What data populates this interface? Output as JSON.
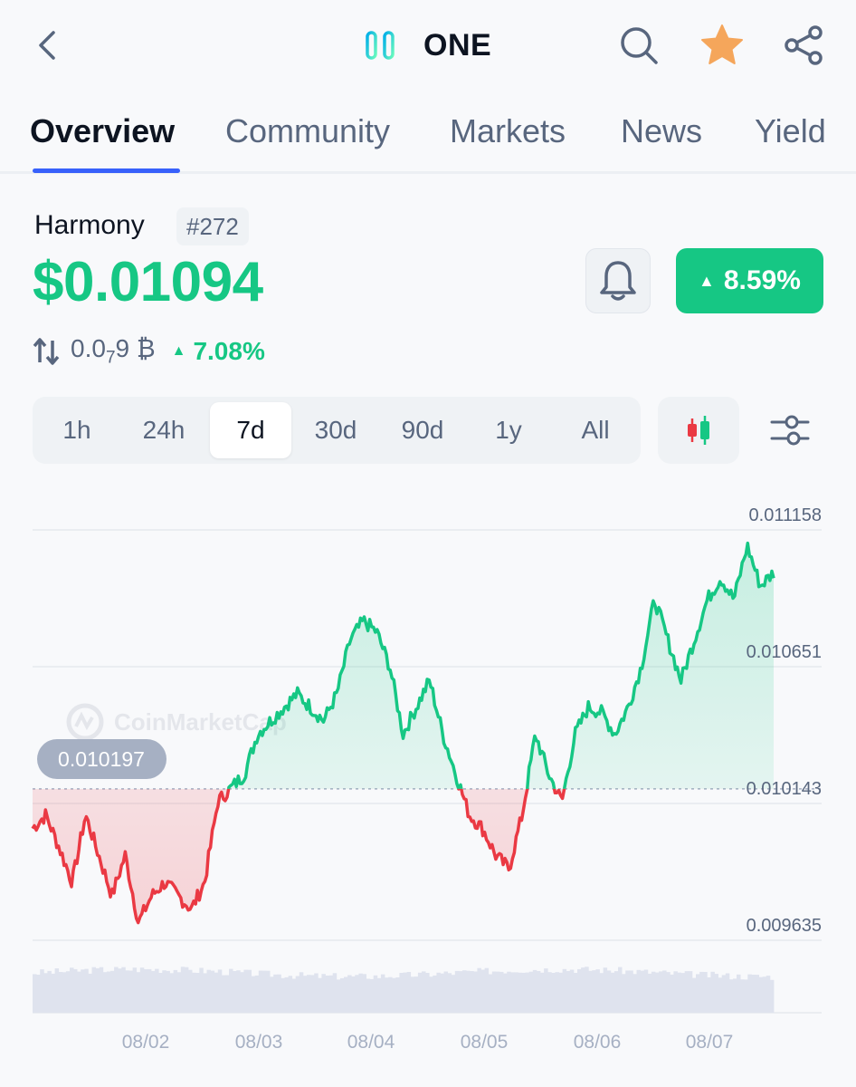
{
  "header": {
    "title": "ONE"
  },
  "tabs": [
    {
      "label": "Overview"
    },
    {
      "label": "Community"
    },
    {
      "label": "Markets"
    },
    {
      "label": "News"
    },
    {
      "label": "Yield"
    }
  ],
  "coin": {
    "name": "Harmony",
    "rank": "#272",
    "price": "$0.01094",
    "change_24h": "8.59%",
    "btc_price_prefix": "0.0",
    "btc_price_sub": "7",
    "btc_price_suffix": "9",
    "btc_symbol": "₿",
    "btc_change": "7.08%"
  },
  "time_ranges": {
    "items": [
      "1h",
      "24h",
      "7d",
      "30d",
      "90d",
      "1y",
      "All"
    ],
    "selected": "7d"
  },
  "colors": {
    "up": "#16c784",
    "down": "#ea3943",
    "accent": "#3861fb",
    "star": "#f5a65b"
  },
  "icons": {
    "back": "chevron-left-icon",
    "search": "search-icon",
    "watchlist": "star-icon",
    "share": "share-icon",
    "alert": "bell-icon",
    "chart_type": "candlestick-icon",
    "settings": "sliders-icon"
  },
  "chart_data": {
    "type": "line",
    "title": "",
    "xlabel": "",
    "ylabel": "",
    "x_ticks": [
      "08/02",
      "08/03",
      "08/04",
      "08/05",
      "08/06",
      "08/07"
    ],
    "y_ticks": [
      "0.011158",
      "0.010651",
      "0.010143",
      "0.009635"
    ],
    "ylim": [
      0.009635,
      0.011158
    ],
    "baseline": 0.010197,
    "baseline_label": "0.010197",
    "watermark": "CoinMarketCap",
    "series": [
      {
        "x": [
          0.0,
          0.1,
          0.2,
          0.3,
          0.4,
          0.5,
          0.6,
          0.7,
          0.8,
          0.9,
          1.0,
          1.1,
          1.2,
          1.3,
          1.4,
          1.5,
          1.6,
          1.7,
          1.8,
          1.9,
          2.0,
          2.1,
          2.2,
          2.3,
          2.4,
          2.5,
          2.6,
          2.7,
          2.8,
          2.9,
          3.0,
          3.1,
          3.2,
          3.3,
          3.4,
          3.5,
          3.6,
          3.7,
          3.8,
          3.9,
          4.0,
          4.1,
          4.2,
          4.3,
          4.4,
          4.5,
          4.6,
          4.7,
          4.8,
          4.9,
          5.0,
          5.1,
          5.2,
          5.3,
          5.4,
          5.5,
          5.6
        ],
        "y": [
          0.01005,
          0.0101,
          0.00998,
          0.00985,
          0.0101,
          0.00995,
          0.0098,
          0.00995,
          0.0097,
          0.0098,
          0.00985,
          0.0098,
          0.00975,
          0.00985,
          0.01015,
          0.0102,
          0.01025,
          0.0104,
          0.01045,
          0.0105,
          0.01055,
          0.0105,
          0.01045,
          0.01055,
          0.01075,
          0.01082,
          0.01078,
          0.01065,
          0.0104,
          0.0105,
          0.0106,
          0.0104,
          0.01025,
          0.0101,
          0.01005,
          0.00995,
          0.0099,
          0.0101,
          0.0104,
          0.01025,
          0.01015,
          0.0104,
          0.0105,
          0.01048,
          0.0104,
          0.0105,
          0.01065,
          0.0109,
          0.01075,
          0.0106,
          0.01075,
          0.0109,
          0.01098,
          0.0109,
          0.0111,
          0.01095,
          0.011
        ]
      }
    ]
  }
}
